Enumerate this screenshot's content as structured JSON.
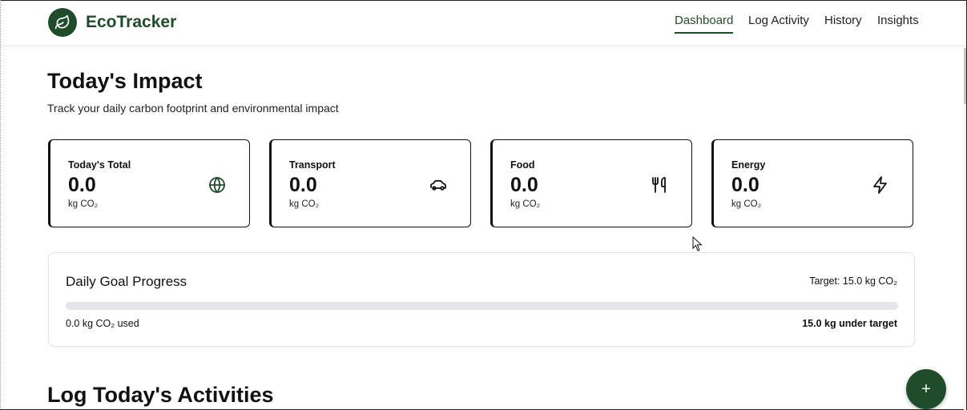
{
  "app": {
    "brand": "EcoTracker",
    "logo_icon": "leaf-icon",
    "accent_color": "#1f4d2b"
  },
  "nav": {
    "items": [
      {
        "label": "Dashboard",
        "active": true
      },
      {
        "label": "Log Activity",
        "active": false
      },
      {
        "label": "History",
        "active": false
      },
      {
        "label": "Insights",
        "active": false
      }
    ]
  },
  "page": {
    "title": "Today's Impact",
    "subtitle": "Track your daily carbon footprint and environmental impact"
  },
  "stats": [
    {
      "label": "Today's Total",
      "value": "0.0",
      "unit": "kg CO₂",
      "icon": "globe-icon"
    },
    {
      "label": "Transport",
      "value": "0.0",
      "unit": "kg CO₂",
      "icon": "car-icon"
    },
    {
      "label": "Food",
      "value": "0.0",
      "unit": "kg CO₂",
      "icon": "utensils-icon"
    },
    {
      "label": "Energy",
      "value": "0.0",
      "unit": "kg CO₂",
      "icon": "lightning-icon"
    }
  ],
  "goal": {
    "title": "Daily Goal Progress",
    "target_text": "Target: 15.0 kg CO₂",
    "progress_fraction": 0.0,
    "used_text": "0.0 kg CO₂ used",
    "under_text": "15.0 kg under target"
  },
  "section": {
    "title": "Log Today's Activities"
  },
  "fab": {
    "label": "+"
  }
}
